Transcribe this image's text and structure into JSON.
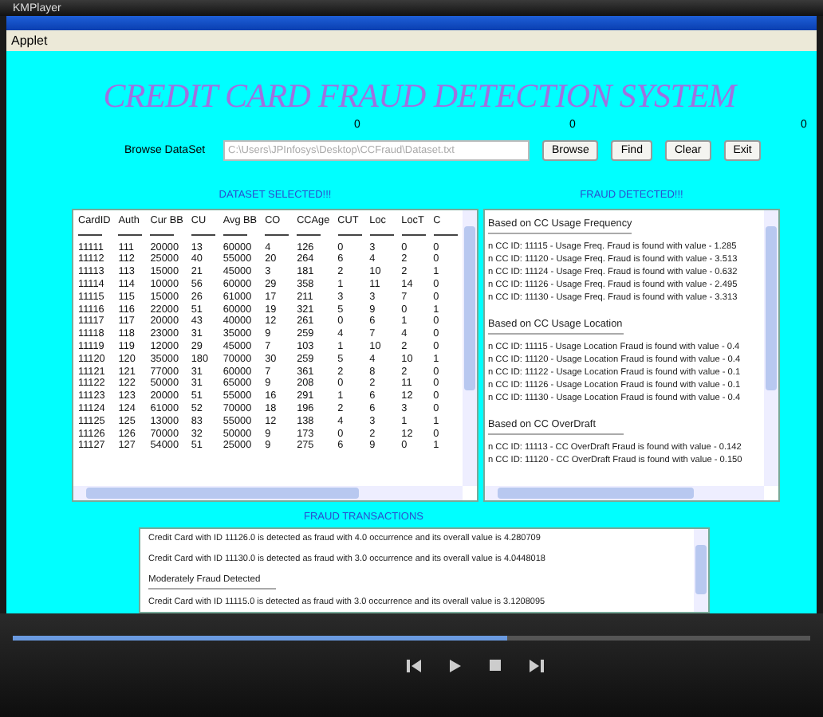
{
  "player": {
    "title": "KMPlayer",
    "seek": {
      "level": 0.62
    }
  },
  "window": {
    "menu": [
      "Applet"
    ]
  },
  "applet": {
    "title": "CREDIT CARD FRAUD DETECTION SYSTEM",
    "counters": [
      "0",
      "0",
      "0"
    ],
    "browse_label": "Browse DataSet",
    "path_field": {
      "value": "C:\\Users\\JPInfosys\\Desktop\\CCFraud\\Dataset.txt"
    },
    "buttons": [
      "Browse",
      "Find",
      "Clear",
      "Exit"
    ],
    "dataset": {
      "heading": "DATASET SELECTED!!!",
      "columns": [
        "CardID",
        "Auth",
        "Cur BB",
        "CU",
        "Avg BB",
        "CO",
        "CCAge",
        "CUT",
        "Loc",
        "LocT",
        "C"
      ],
      "rows": [
        [
          "11111",
          "111",
          "20000",
          "13",
          "60000",
          "4",
          "126",
          "0",
          "3",
          "0",
          "0"
        ],
        [
          "11112",
          "112",
          "25000",
          "40",
          "55000",
          "20",
          "264",
          "6",
          "4",
          "2",
          "0"
        ],
        [
          "11113",
          "113",
          "15000",
          "21",
          "45000",
          "3",
          "181",
          "2",
          "10",
          "2",
          "1"
        ],
        [
          "11114",
          "114",
          "10000",
          "56",
          "60000",
          "29",
          "358",
          "1",
          "11",
          "14",
          "0"
        ],
        [
          "11115",
          "115",
          "15000",
          "26",
          "61000",
          "17",
          "211",
          "3",
          "3",
          "7",
          "0"
        ],
        [
          "11116",
          "116",
          "22000",
          "51",
          "60000",
          "19",
          "321",
          "5",
          "9",
          "0",
          "1"
        ],
        [
          "11117",
          "117",
          "20000",
          "43",
          "40000",
          "12",
          "261",
          "0",
          "6",
          "1",
          "0"
        ],
        [
          "11118",
          "118",
          "23000",
          "31",
          "35000",
          "9",
          "259",
          "4",
          "7",
          "4",
          "0"
        ],
        [
          "11119",
          "119",
          "12000",
          "29",
          "45000",
          "7",
          "103",
          "1",
          "10",
          "2",
          "0"
        ],
        [
          "11120",
          "120",
          "35000",
          "180",
          "70000",
          "30",
          "259",
          "5",
          "4",
          "10",
          "1"
        ],
        [
          "11121",
          "121",
          "77000",
          "31",
          "60000",
          "7",
          "361",
          "2",
          "8",
          "2",
          "0"
        ],
        [
          "11122",
          "122",
          "50000",
          "31",
          "65000",
          "9",
          "208",
          "0",
          "2",
          "11",
          "0"
        ],
        [
          "11123",
          "123",
          "20000",
          "51",
          "55000",
          "16",
          "291",
          "1",
          "6",
          "12",
          "0"
        ],
        [
          "11124",
          "124",
          "61000",
          "52",
          "70000",
          "18",
          "196",
          "2",
          "6",
          "3",
          "0"
        ],
        [
          "11125",
          "125",
          "13000",
          "83",
          "55000",
          "12",
          "138",
          "4",
          "3",
          "1",
          "1"
        ],
        [
          "11126",
          "126",
          "70000",
          "32",
          "50000",
          "9",
          "173",
          "0",
          "2",
          "12",
          "0"
        ],
        [
          "11127",
          "127",
          "54000",
          "51",
          "25000",
          "9",
          "275",
          "6",
          "9",
          "0",
          "1"
        ]
      ]
    },
    "fraud_detected": {
      "heading": "FRAUD DETECTED!!!",
      "lines": [
        {
          "kind": "heading",
          "text": "Based on CC Usage Frequency"
        },
        {
          "kind": "entry",
          "text": "n CC ID: 11115 - Usage Freq. Fraud is found with value - 1.285"
        },
        {
          "kind": "entry",
          "text": "n CC ID: 11120 - Usage Freq. Fraud is found with value - 3.513"
        },
        {
          "kind": "entry",
          "text": "n CC ID: 11124 - Usage Freq. Fraud is found with value - 0.632"
        },
        {
          "kind": "entry",
          "text": "n CC ID: 11126 - Usage Freq. Fraud is found with value - 2.495"
        },
        {
          "kind": "entry",
          "text": "n CC ID: 11130 - Usage Freq. Fraud is found with value - 3.313"
        },
        {
          "kind": "heading",
          "text": "Based on CC Usage Location"
        },
        {
          "kind": "entry",
          "text": "n CC ID: 11115 - Usage Location Fraud is found with value - 0.4"
        },
        {
          "kind": "entry",
          "text": "n CC ID: 11120 - Usage Location Fraud is found with value - 0.4"
        },
        {
          "kind": "entry",
          "text": "n CC ID: 11122 - Usage Location Fraud is found with value - 0.1"
        },
        {
          "kind": "entry",
          "text": "n CC ID: 11126 - Usage Location Fraud is found with value - 0.1"
        },
        {
          "kind": "entry",
          "text": "n CC ID: 11130 - Usage Location Fraud is found with value - 0.4"
        },
        {
          "kind": "heading",
          "text": "Based on CC OverDraft"
        },
        {
          "kind": "entry",
          "text": "n CC ID: 11113 - CC OverDraft Fraud is found with value - 0.142"
        },
        {
          "kind": "entry",
          "text": "n CC ID: 11120 - CC OverDraft Fraud is found with value - 0.150"
        }
      ]
    },
    "fraud_transactions": {
      "heading": "FRAUD TRANSACTIONS",
      "lines": [
        {
          "kind": "entry",
          "text": "Credit Card with ID 11126.0 is detected as fraud with 4.0 occurrence and its overall value is 4.280709"
        },
        {
          "kind": "entry",
          "text": "Credit Card with ID 11130.0 is detected as fraud with 3.0 occurrence and its overall value is 4.0448018"
        },
        {
          "kind": "heading",
          "text": "Moderately Fraud Detected"
        },
        {
          "kind": "entry",
          "text": "Credit Card with ID 11115.0 is detected as fraud with 3.0 occurrence and its overall value is 3.1208095"
        }
      ]
    }
  }
}
